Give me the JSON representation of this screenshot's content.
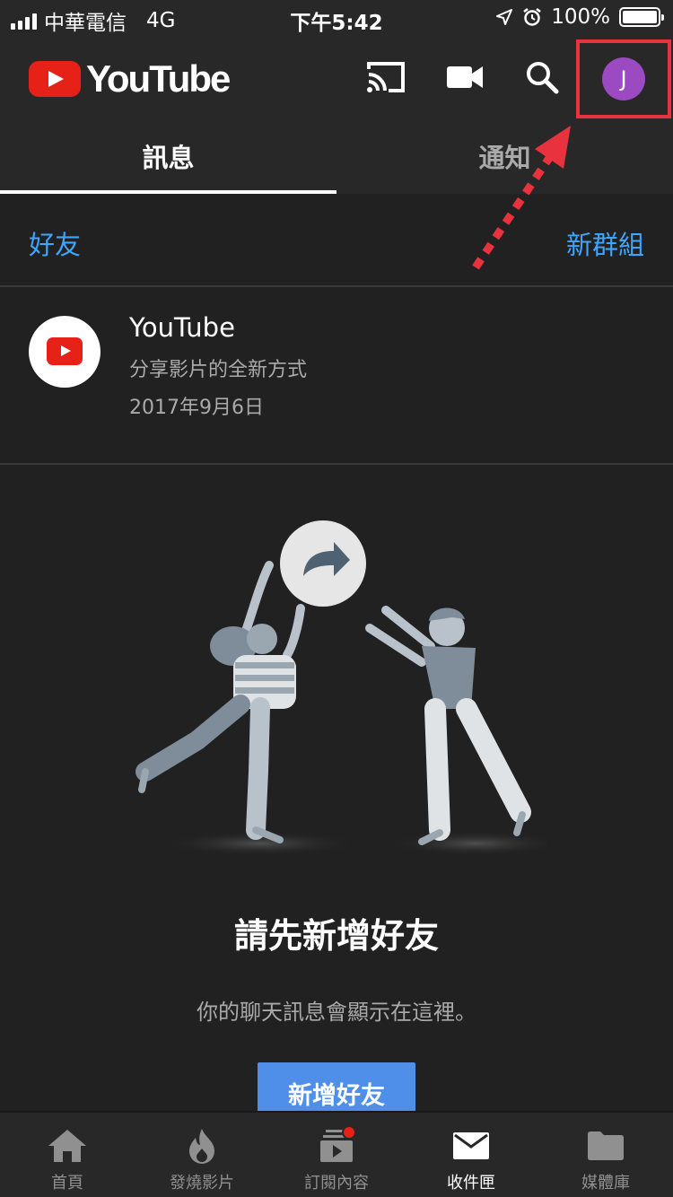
{
  "status_bar": {
    "carrier": "中華電信",
    "network": "4G",
    "time": "下午5:42",
    "battery": "100%"
  },
  "header": {
    "logo_text": "YouTube",
    "icons": [
      "cast-icon",
      "video-camera-icon",
      "search-icon"
    ],
    "avatar_initial": "J",
    "avatar_color": "#9b4ac2",
    "highlight_color": "#e8333f"
  },
  "tabs": [
    {
      "label": "訊息",
      "active": true
    },
    {
      "label": "通知",
      "active": false
    }
  ],
  "friends_row": {
    "friends_label": "好友",
    "new_group_label": "新群組",
    "accent": "#3ea6ff"
  },
  "conversation": {
    "name": "YouTube",
    "subtitle": "分享影片的全新方式",
    "date": "2017年9月6日"
  },
  "empty_state": {
    "title": "請先新增好友",
    "subtitle": "你的聊天訊息會顯示在這裡。",
    "button_label": "新增好友",
    "button_color": "#4f8fea"
  },
  "bottom_nav": [
    {
      "label": "首頁",
      "icon": "home-icon",
      "active": false
    },
    {
      "label": "發燒影片",
      "icon": "flame-icon",
      "active": false
    },
    {
      "label": "訂閱內容",
      "icon": "subscriptions-icon",
      "active": false,
      "badge": true
    },
    {
      "label": "收件匣",
      "icon": "inbox-icon",
      "active": true
    },
    {
      "label": "媒體庫",
      "icon": "folder-icon",
      "active": false
    }
  ]
}
